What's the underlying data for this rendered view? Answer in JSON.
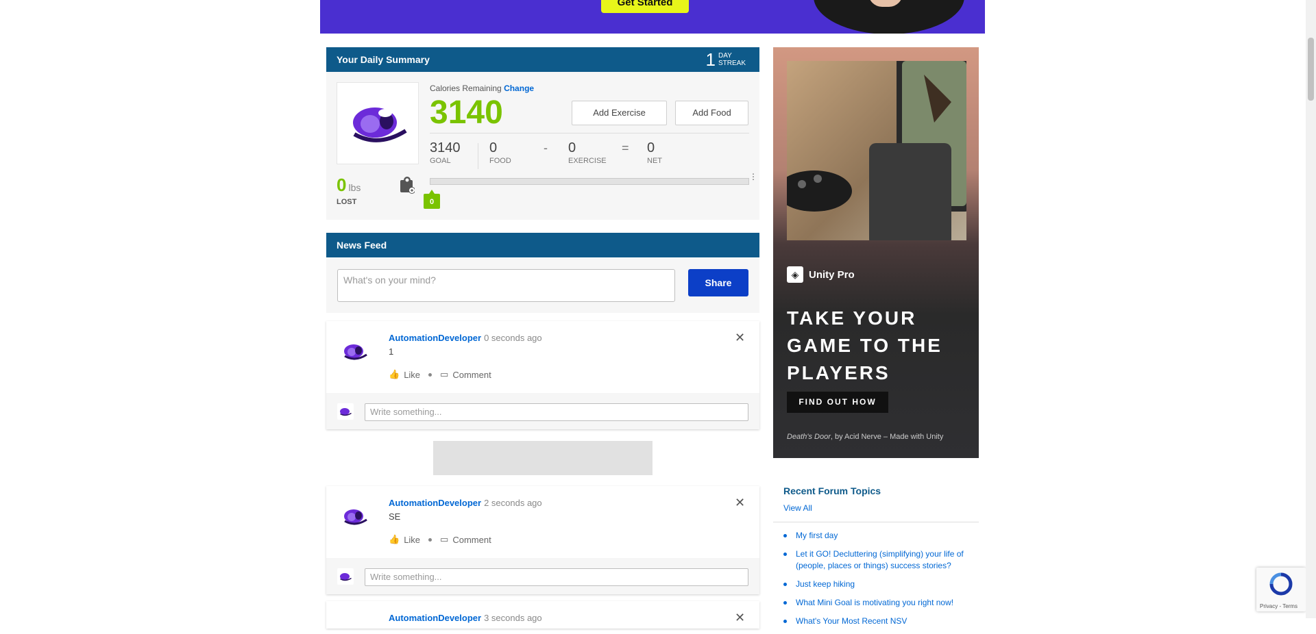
{
  "banner": {
    "cta_label": "Get Started"
  },
  "summary": {
    "title": "Your Daily Summary",
    "streak_number": "1",
    "streak_line1": "DAY",
    "streak_line2": "STREAK",
    "calories_label": "Calories Remaining",
    "change_label": "Change",
    "calories_remaining": "3140",
    "add_exercise": "Add Exercise",
    "add_food": "Add Food",
    "goal": {
      "value": "3140",
      "label": "GOAL"
    },
    "food": {
      "value": "0",
      "label": "FOOD"
    },
    "minus": "-",
    "exercise": {
      "value": "0",
      "label": "EXERCISE"
    },
    "equals": "=",
    "net": {
      "value": "0",
      "label": "NET"
    },
    "lbs_value": "0",
    "lbs_unit": "lbs",
    "lbs_label": "LOST",
    "progress_marker": "0",
    "progress_fraction": 0
  },
  "newsfeed": {
    "title": "News Feed",
    "compose_placeholder": "What's on your mind?",
    "share_label": "Share",
    "like_label": "Like",
    "comment_label": "Comment",
    "comment_placeholder": "Write something...",
    "posts": [
      {
        "user": "AutomationDeveloper",
        "time": "0 seconds ago",
        "text": "1"
      },
      {
        "user": "AutomationDeveloper",
        "time": "2 seconds ago",
        "text": "SE"
      },
      {
        "user": "AutomationDeveloper",
        "time": "3 seconds ago",
        "text": ""
      }
    ]
  },
  "side_ad": {
    "brand": "Unity Pro",
    "headline": "TAKE YOUR GAME TO THE PLAYERS",
    "cta": "FIND OUT HOW",
    "footer_game": "Death's Door",
    "footer_rest": ", by Acid Nerve – Made with Unity"
  },
  "forum": {
    "title": "Recent Forum Topics",
    "view_all": "View All",
    "topics": [
      "My first day",
      "Let it GO! Decluttering (simplifying) your life of (people, places or things) success stories?",
      "Just keep hiking",
      "What Mini Goal is motivating you right now!",
      "What's Your Most Recent NSV"
    ]
  },
  "recaptcha": {
    "text": "Privacy - Terms"
  },
  "colors": {
    "header_blue": "#0e5a8a",
    "accent_green": "#7ac300",
    "link_blue": "#0067d4",
    "share_blue": "#0c3fc7"
  }
}
